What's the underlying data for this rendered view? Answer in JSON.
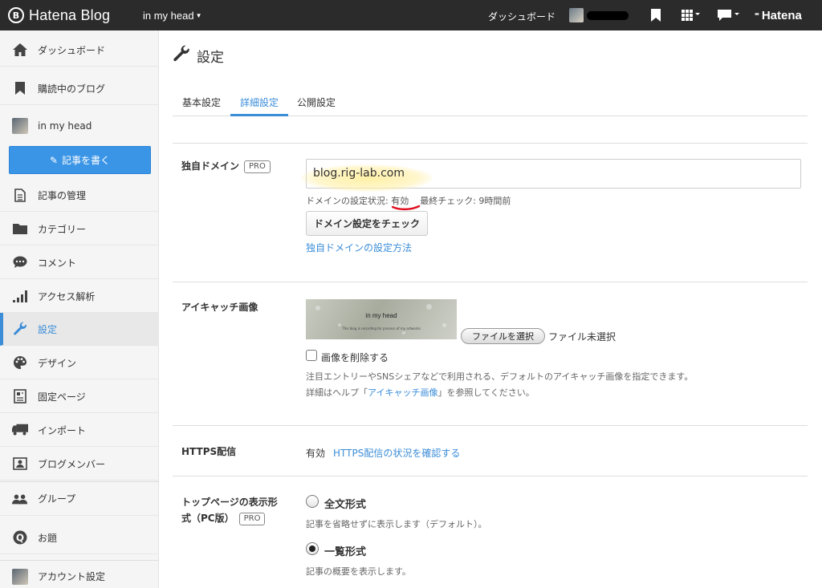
{
  "topbar": {
    "logo_text": "Hatena Blog",
    "logo_mark": "B",
    "blog_name": "in my head",
    "dashboard": "ダッシュボード",
    "hatena": "Hatena"
  },
  "sidebar": {
    "items": [
      {
        "label": "ダッシュボード",
        "icon": "home-icon"
      },
      {
        "label": "購読中のブログ",
        "icon": "bookmark-icon"
      },
      {
        "label": "in my head",
        "icon": "blog-avatar"
      },
      {
        "label": "記事の管理",
        "icon": "document-icon"
      },
      {
        "label": "カテゴリー",
        "icon": "folder-icon"
      },
      {
        "label": "コメント",
        "icon": "comment-icon"
      },
      {
        "label": "アクセス解析",
        "icon": "bar-chart-icon"
      },
      {
        "label": "設定",
        "icon": "wrench-icon"
      },
      {
        "label": "デザイン",
        "icon": "palette-icon"
      },
      {
        "label": "固定ページ",
        "icon": "page-icon"
      },
      {
        "label": "インポート",
        "icon": "truck-icon"
      },
      {
        "label": "ブログメンバー",
        "icon": "member-icon"
      },
      {
        "label": "グループ",
        "icon": "group-icon"
      },
      {
        "label": "お題",
        "icon": "question-icon"
      },
      {
        "label": "アカウント設定",
        "icon": "account-avatar"
      }
    ],
    "write_button": "記事を書く",
    "active_index": 7
  },
  "main": {
    "title": "設定",
    "tabs": [
      "基本設定",
      "詳細設定",
      "公開設定"
    ],
    "active_tab": 1,
    "domain": {
      "label": "独自ドメイン",
      "pro": "PRO",
      "value": "blog.rig-lab.com",
      "status_prefix": "ドメインの設定状況: ",
      "status_value": "有効",
      "last_check": "最終チェック: 9時間前",
      "check_button": "ドメイン設定をチェック",
      "help_link": "独自ドメインの設定方法"
    },
    "eyecatch": {
      "label": "アイキャッチ画像",
      "image_title": "in my head",
      "image_subtitle": "This blog is recording for process of my artworks",
      "file_button": "ファイルを選択",
      "file_status": "ファイル未選択",
      "delete_label": "画像を削除する",
      "help1": "注目エントリーやSNSシェアなどで利用される、デフォルトのアイキャッチ画像を指定できます。",
      "help2_prefix": "詳細はヘルプ「",
      "help2_link": "アイキャッチ画像",
      "help2_suffix": "」を参照してください。"
    },
    "https": {
      "label": "HTTPS配信",
      "value": "有効",
      "link": "HTTPS配信の状況を確認する"
    },
    "toppage": {
      "label_line1": "トップページの表示形",
      "label_line2": "式（PC版）",
      "pro": "PRO",
      "option1": "全文形式",
      "option1_desc": "記事を省略せずに表示します（デフォルト）。",
      "option2": "一覧形式",
      "option2_desc": "記事の概要を表示します。",
      "selected": 1
    }
  }
}
